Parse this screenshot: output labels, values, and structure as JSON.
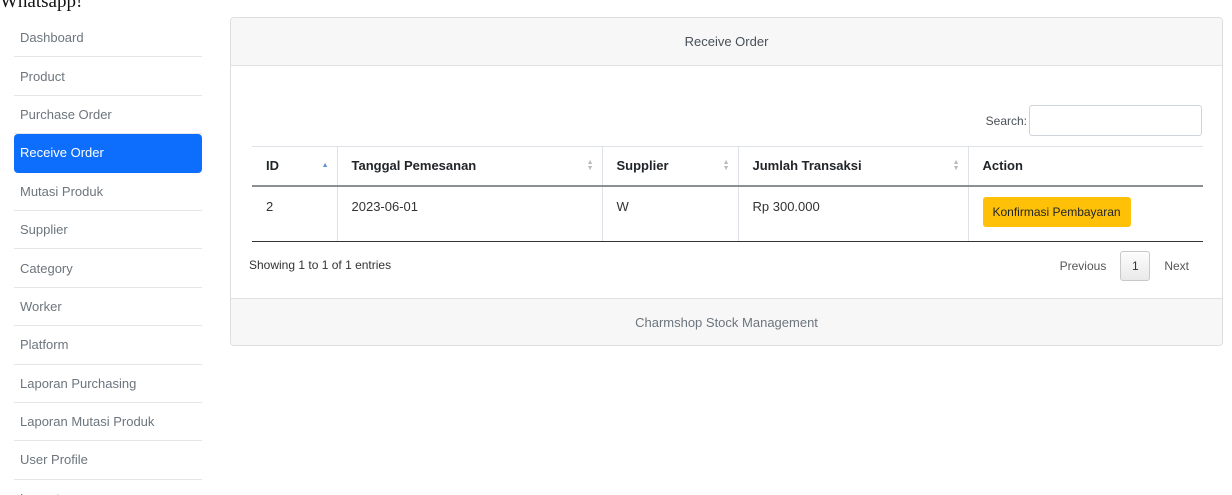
{
  "app": {
    "brand": "Whatsapp!"
  },
  "sidebar": {
    "items": [
      {
        "label": "Dashboard",
        "active": false
      },
      {
        "label": "Product",
        "active": false
      },
      {
        "label": "Purchase Order",
        "active": false
      },
      {
        "label": "Receive Order",
        "active": true
      },
      {
        "label": "Mutasi Produk",
        "active": false
      },
      {
        "label": "Supplier",
        "active": false
      },
      {
        "label": "Category",
        "active": false
      },
      {
        "label": "Worker",
        "active": false
      },
      {
        "label": "Platform",
        "active": false
      },
      {
        "label": "Laporan Purchasing",
        "active": false
      },
      {
        "label": "Laporan Mutasi Produk",
        "active": false
      },
      {
        "label": "User Profile",
        "active": false
      },
      {
        "label": "Logout",
        "active": false
      }
    ]
  },
  "card": {
    "title": "Receive Order",
    "footer": "Charmshop Stock Management"
  },
  "search": {
    "label": "Search:",
    "value": ""
  },
  "table": {
    "headers": [
      "ID",
      "Tanggal Pemesanan",
      "Supplier",
      "Jumlah Transaksi",
      "Action"
    ],
    "rows": [
      {
        "id": "2",
        "date": "2023-06-01",
        "supplier": "W",
        "amount": "Rp 300.000",
        "action": "Konfirmasi Pembayaran"
      }
    ]
  },
  "info": "Showing 1 to 1 of 1 entries",
  "pagination": {
    "previous": "Previous",
    "current": "1",
    "next": "Next"
  },
  "colors": {
    "active_nav": "#0d6efd",
    "action_button": "#ffc107",
    "card_header_bg": "#f7f7f7"
  },
  "icons": {
    "sort_asc": "sort-ascending-icon",
    "sort_both": "sort-both-icon"
  }
}
